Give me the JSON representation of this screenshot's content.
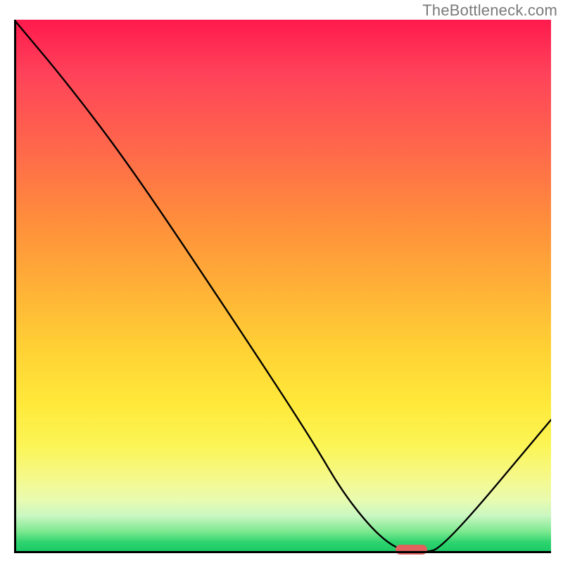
{
  "watermark": "TheBottleneck.com",
  "chart_data": {
    "type": "line",
    "title": "",
    "xlabel": "",
    "ylabel": "",
    "xlim": [
      0,
      100
    ],
    "ylim": [
      0,
      100
    ],
    "grid": false,
    "legend": false,
    "series": [
      {
        "name": "bottleneck-curve",
        "x": [
          0,
          10,
          22,
          40,
          55,
          62,
          70,
          76,
          80,
          100
        ],
        "y": [
          100,
          88,
          72,
          45,
          22,
          10,
          1,
          0,
          1,
          25
        ]
      }
    ],
    "marker": {
      "name": "optimal-point",
      "x_center": 74,
      "width_pct": 6,
      "y": 0,
      "color": "#e0615e"
    },
    "background_gradient": {
      "top_color": "#ff1a4d",
      "mid_color": "#ffd234",
      "bottom_color": "#18c864"
    }
  }
}
